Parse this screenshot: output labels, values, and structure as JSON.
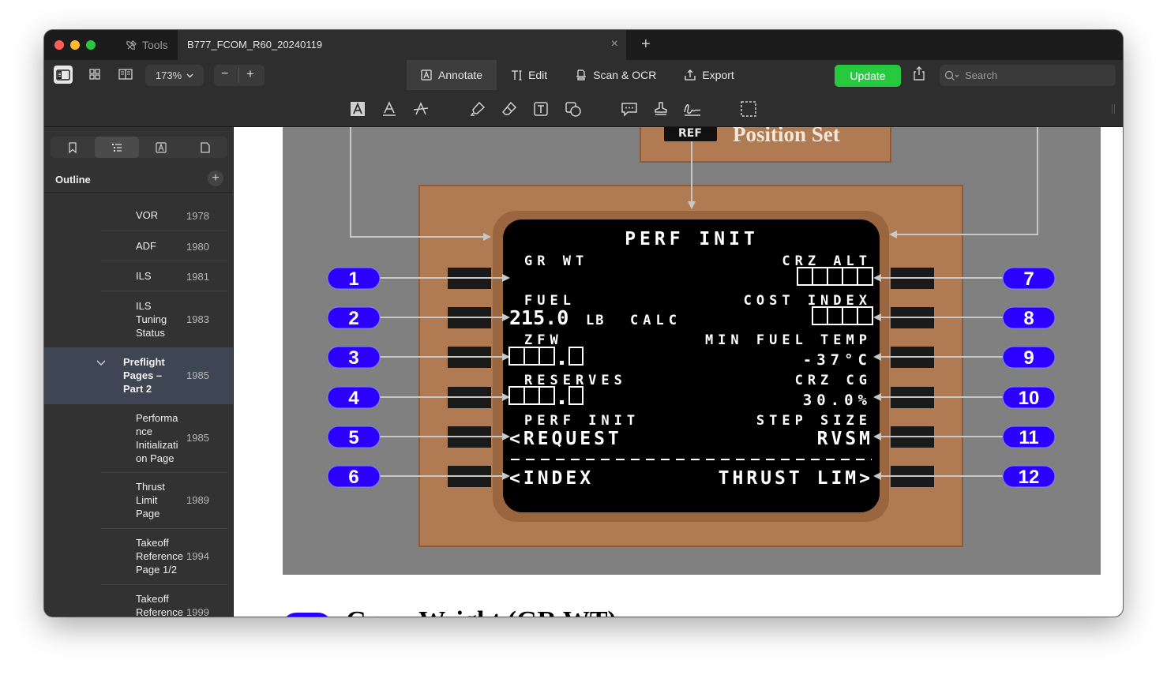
{
  "tabbar": {
    "tools_label": "Tools",
    "document_title": "B777_FCOM_R60_20240119",
    "close_glyph": "×",
    "new_tab_glyph": "+"
  },
  "toolbar": {
    "zoom_value": "173%",
    "zoom_out_glyph": "−",
    "zoom_in_glyph": "+",
    "modes": [
      {
        "label": "Annotate",
        "icon": "annotate-icon",
        "active": true
      },
      {
        "label": "Edit",
        "icon": "edit-cursor-icon",
        "active": false
      },
      {
        "label": "Scan & OCR",
        "icon": "scan-icon",
        "active": false
      },
      {
        "label": "Export",
        "icon": "export-icon",
        "active": false
      }
    ],
    "update_label": "Update",
    "search_placeholder": "Search",
    "accent_color": "#27c93f"
  },
  "annotation_tools": [
    "text-box-icon",
    "underline-icon",
    "strikethrough-icon",
    "highlighter-icon",
    "eraser-icon",
    "text-frame-icon",
    "shapes-icon",
    "comment-icon",
    "stamp-icon",
    "signature-icon",
    "selection-icon"
  ],
  "sidebar": {
    "tabs": [
      "bookmark-icon",
      "outline-icon",
      "annotations-icon",
      "page-icon"
    ],
    "outline_title": "Outline",
    "items": [
      {
        "label": "VOR",
        "page": "1978"
      },
      {
        "label": "ADF",
        "page": "1980"
      },
      {
        "label": "ILS",
        "page": "1981"
      },
      {
        "label": "ILS\nTuning\nStatus",
        "page": "1983"
      },
      {
        "label": "Preflight\nPages –\nPart 2",
        "page": "1985",
        "selected": true
      },
      {
        "label": "Performa\nnce\nInitializati\non Page",
        "page": "1985"
      },
      {
        "label": "Thrust\nLimit\nPage",
        "page": "1989"
      },
      {
        "label": "Takeoff\nReference\nPage 1/2",
        "page": "1994"
      },
      {
        "label": "Takeoff\nReference",
        "page": "1999"
      }
    ]
  },
  "figure": {
    "top_label_ref": "REF",
    "top_label_text": "Position Set",
    "cdu_title": "PERF INIT",
    "left_labels": [
      "GR WT",
      "FUEL",
      "ZFW",
      "RESERVES",
      "PERF INIT"
    ],
    "fuel_value": "215.0",
    "fuel_unit": "LB",
    "fuel_calc": "CALC",
    "left_actions": [
      "<REQUEST",
      "<INDEX"
    ],
    "right_labels": [
      "CRZ ALT",
      "COST INDEX",
      "MIN FUEL TEMP",
      "CRZ CG",
      "STEP SIZE"
    ],
    "right_values": [
      "-37°C",
      "30.0%",
      "RVSM"
    ],
    "right_action": "THRUST LIM>",
    "left_callouts": [
      "1",
      "2",
      "3",
      "4",
      "5",
      "6"
    ],
    "right_callouts": [
      "7",
      "8",
      "9",
      "10",
      "11",
      "12"
    ]
  },
  "document": {
    "next_heading": "Gross Weight (GR WT)",
    "callout_color": "#2b00ff",
    "bezel_color": "#b07a52"
  }
}
